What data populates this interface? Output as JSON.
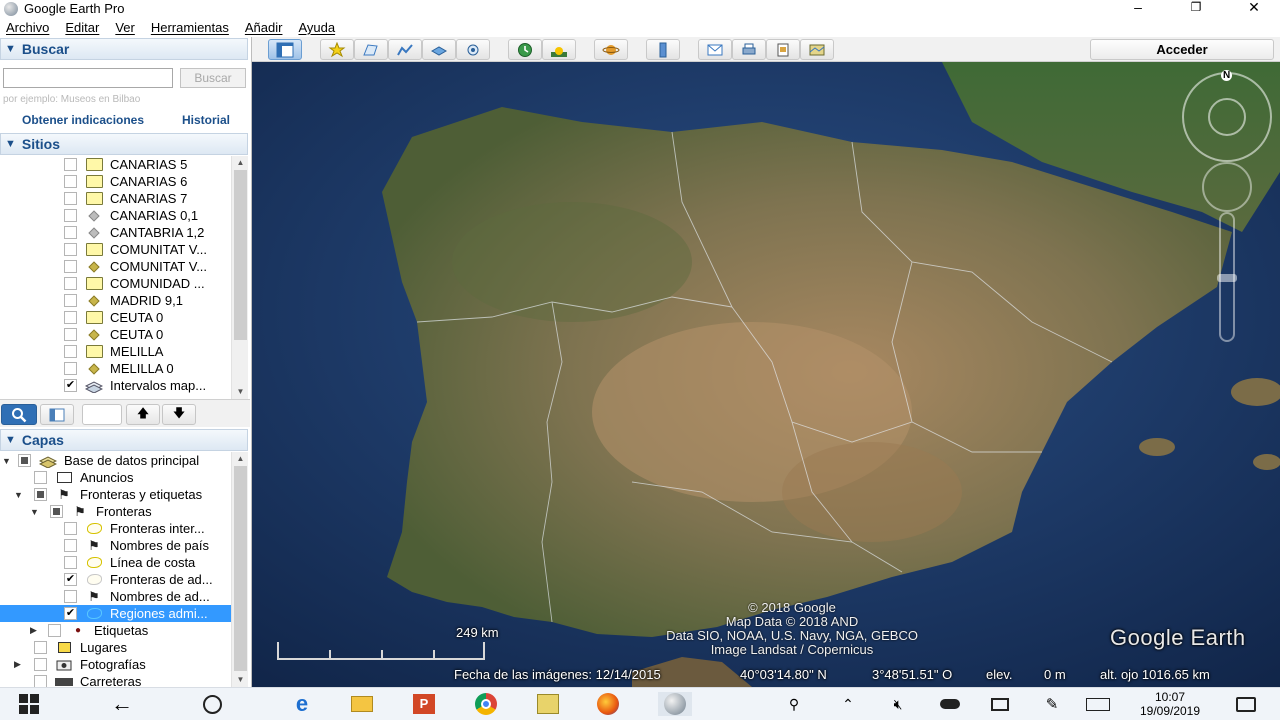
{
  "window": {
    "title": "Google Earth Pro",
    "minimize": "–",
    "maximize": "❐",
    "close": "✕"
  },
  "menu": [
    "Archivo",
    "Editar",
    "Ver",
    "Herramientas",
    "Añadir",
    "Ayuda"
  ],
  "toolbar": {
    "sign_in": "Acceder"
  },
  "search": {
    "header": "Buscar",
    "placeholder": "",
    "button": "Buscar",
    "hint": "por ejemplo: Museos en Bilbao",
    "directions_link": "Obtener indicaciones",
    "history_link": "Historial"
  },
  "places": {
    "header": "Sitios",
    "items": [
      {
        "label": "CANARIAS 5",
        "icon": "folder-icon",
        "checked": false
      },
      {
        "label": "CANARIAS 6",
        "icon": "folder-icon",
        "checked": false
      },
      {
        "label": "CANARIAS 7",
        "icon": "folder-icon",
        "checked": false
      },
      {
        "label": "CANARIAS 0,1",
        "icon": "placemark-gray-icon",
        "checked": false
      },
      {
        "label": "CANTABRIA 1,2",
        "icon": "placemark-gray-icon",
        "checked": false
      },
      {
        "label": "COMUNITAT V...",
        "icon": "folder-icon",
        "checked": false
      },
      {
        "label": "COMUNITAT V...",
        "icon": "placemark-icon",
        "checked": false
      },
      {
        "label": "COMUNIDAD ...",
        "icon": "folder-icon",
        "checked": false
      },
      {
        "label": "MADRID 9,1",
        "icon": "placemark-icon",
        "checked": false
      },
      {
        "label": "CEUTA 0",
        "icon": "folder-icon",
        "checked": false
      },
      {
        "label": "CEUTA 0",
        "icon": "placemark-icon",
        "checked": false
      },
      {
        "label": "MELILLA",
        "icon": "folder-icon",
        "checked": false
      },
      {
        "label": "MELILLA 0",
        "icon": "placemark-icon",
        "checked": false
      },
      {
        "label": "Intervalos map...",
        "icon": "layers-icon",
        "checked": true
      }
    ]
  },
  "layers": {
    "header": "Capas",
    "items": [
      {
        "label": "Base de datos principal",
        "icon": "database-icon",
        "checked": "mixed",
        "expand": "▼"
      },
      {
        "label": "Anuncios",
        "icon": "envelope-icon",
        "checked": false,
        "expand": ""
      },
      {
        "label": "Fronteras y etiquetas",
        "icon": "flag-icon",
        "checked": "mixed",
        "expand": "▼"
      },
      {
        "label": "Fronteras",
        "icon": "flag-icon",
        "checked": "mixed",
        "expand": "▼"
      },
      {
        "label": "Fronteras inter...",
        "icon": "border-yellow-icon",
        "checked": false,
        "expand": ""
      },
      {
        "label": "Nombres de país",
        "icon": "flag-icon",
        "checked": false,
        "expand": ""
      },
      {
        "label": "Línea de costa",
        "icon": "border-yellow-icon",
        "checked": false,
        "expand": ""
      },
      {
        "label": "Fronteras de ad...",
        "icon": "border-gray-icon",
        "checked": true,
        "expand": ""
      },
      {
        "label": "Nombres de ad...",
        "icon": "flag-icon",
        "checked": false,
        "expand": ""
      },
      {
        "label": "Regiones admi...",
        "icon": "border-cyan-icon",
        "checked": true,
        "expand": ""
      },
      {
        "label": "Etiquetas",
        "icon": "dot-icon",
        "checked": false,
        "expand": "▶"
      },
      {
        "label": "Lugares",
        "icon": "places-icon",
        "checked": false,
        "expand": ""
      },
      {
        "label": "Fotografías",
        "icon": "camera-icon",
        "checked": false,
        "expand": "▶"
      },
      {
        "label": "Carreteras",
        "icon": "road-icon",
        "checked": false,
        "expand": ""
      }
    ]
  },
  "map": {
    "scale": "249 km",
    "credits": [
      "© 2018 Google",
      "Map Data © 2018 AND",
      "Data SIO, NOAA, U.S. Navy, NGA, GEBCO",
      "Image Landsat / Copernicus"
    ],
    "brand": "Google Earth",
    "compass_north": "N",
    "status": {
      "imagery_date": "Fecha de las imágenes: 12/14/2015",
      "lat": "40°03'14.80\" N",
      "lon": "3°48'51.51\" O",
      "elev": "elev.",
      "elev_value": "0 m",
      "eye_alt": "alt. ojo 1016.65 km"
    }
  },
  "taskbar": {
    "time": "10:07",
    "date": "19/09/2019"
  },
  "colors": {
    "accent": "#1b4f8a",
    "selection": "#3399ff",
    "ocean": "#17325c"
  }
}
